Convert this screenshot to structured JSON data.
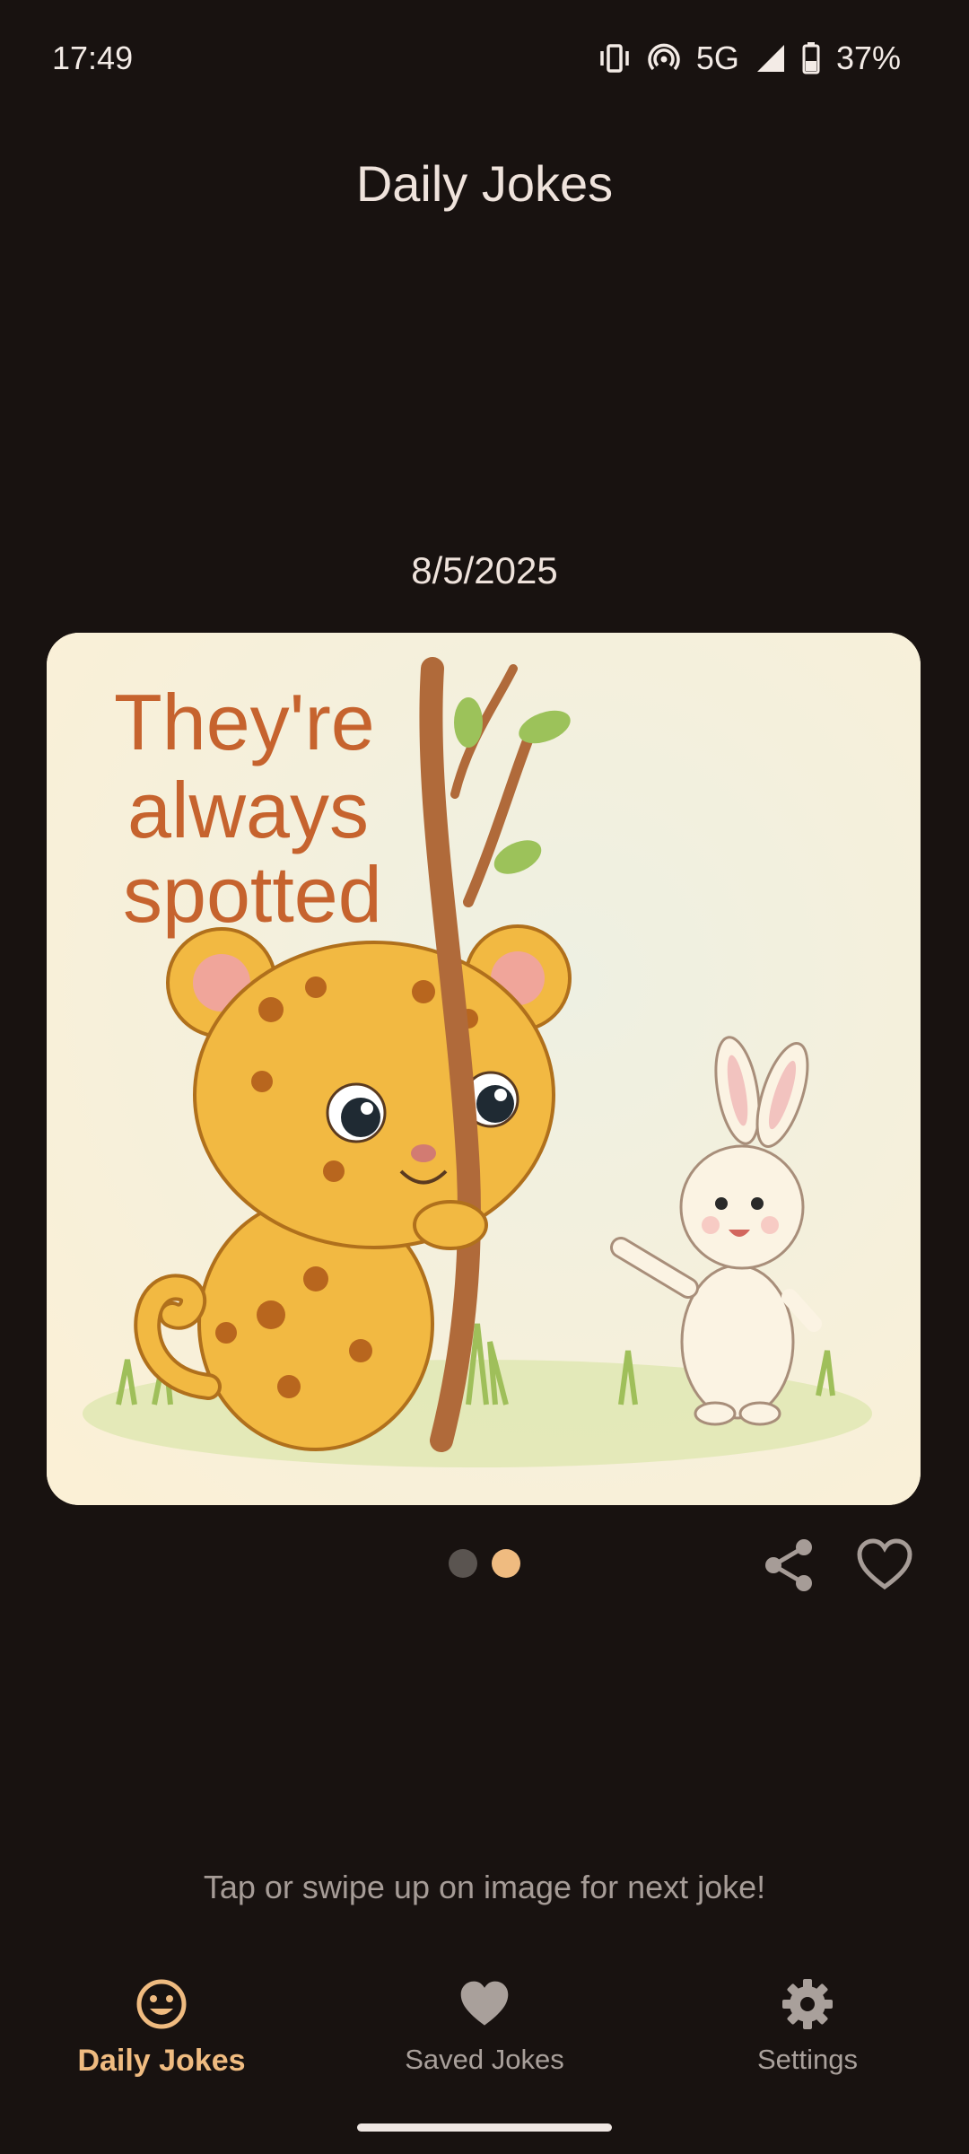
{
  "status_bar": {
    "time": "17:49",
    "network": "5G",
    "battery": "37%",
    "icons": [
      "vibrate-icon",
      "hotspot-icon",
      "signal-icon",
      "battery-icon"
    ]
  },
  "header": {
    "title": "Daily Jokes"
  },
  "joke": {
    "date": "8/5/2025",
    "image_text": [
      "They're",
      "always",
      "spotted"
    ],
    "pager": {
      "count": 2,
      "active_index": 1
    }
  },
  "actions": {
    "share_icon": "share-icon",
    "favorite_icon": "heart-outline-icon"
  },
  "hint": "Tap or swipe up on image for next joke!",
  "nav": {
    "items": [
      {
        "label": "Daily Jokes",
        "icon": "smiley-icon",
        "active": true
      },
      {
        "label": "Saved Jokes",
        "icon": "heart-icon",
        "active": false
      },
      {
        "label": "Settings",
        "icon": "gear-icon",
        "active": false
      }
    ]
  },
  "colors": {
    "background": "#181210",
    "accent": "#efbb80",
    "text": "#efe3dc",
    "muted": "#a69c97"
  }
}
